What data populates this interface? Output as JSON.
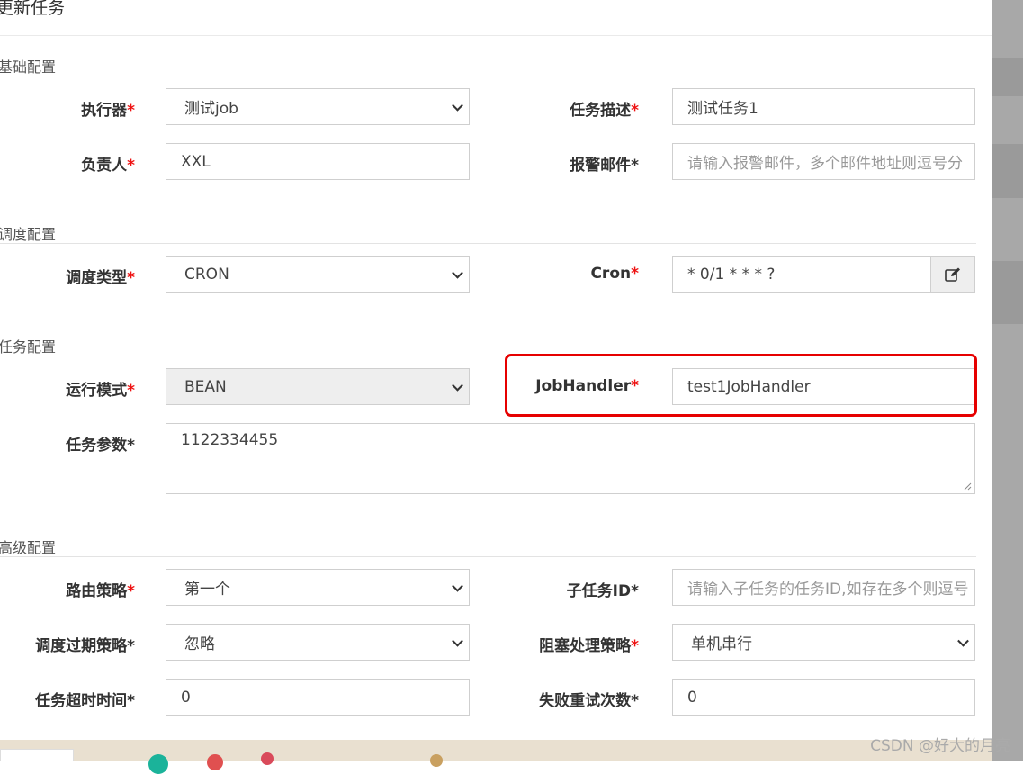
{
  "modal": {
    "title": "更新任务"
  },
  "sections": {
    "basic": "基础配置",
    "schedule": "调度配置",
    "task": "任务配置",
    "advanced": "高级配置"
  },
  "fields": {
    "executor": {
      "label": "执行器",
      "value": "测试job"
    },
    "job_desc": {
      "label": "任务描述",
      "value": "测试任务1"
    },
    "author": {
      "label": "负责人",
      "value": "XXL"
    },
    "alarm_email": {
      "label": "报警邮件*",
      "placeholder": "请输入报警邮件，多个邮件地址则逗号分"
    },
    "schedule_type": {
      "label": "调度类型",
      "value": "CRON"
    },
    "cron": {
      "label": "Cron",
      "value": "* 0/1 * * * ?"
    },
    "glue_type": {
      "label": "运行模式",
      "value": "BEAN"
    },
    "job_handler": {
      "label": "JobHandler",
      "value": "test1JobHandler"
    },
    "job_param": {
      "label": "任务参数*",
      "value": "1122334455"
    },
    "route_strategy": {
      "label": "路由策略",
      "value": "第一个"
    },
    "child_job_id": {
      "label": "子任务ID*",
      "placeholder": "请输入子任务的任务ID,如存在多个则逗号"
    },
    "misfire_strategy": {
      "label": "调度过期策略*",
      "value": "忽略"
    },
    "block_strategy": {
      "label": "阻塞处理策略",
      "value": "单机串行"
    },
    "timeout": {
      "label": "任务超时时间*",
      "value": "0"
    },
    "fail_retry": {
      "label": "失败重试次数*",
      "value": "0"
    }
  },
  "required_mark": "*",
  "icons": {
    "cron_edit": "edit-icon",
    "select": "chevron-down-icon"
  },
  "colors": {
    "highlight": "#e60000",
    "required": "#e11111"
  },
  "watermark": "CSDN @好大的月亮"
}
